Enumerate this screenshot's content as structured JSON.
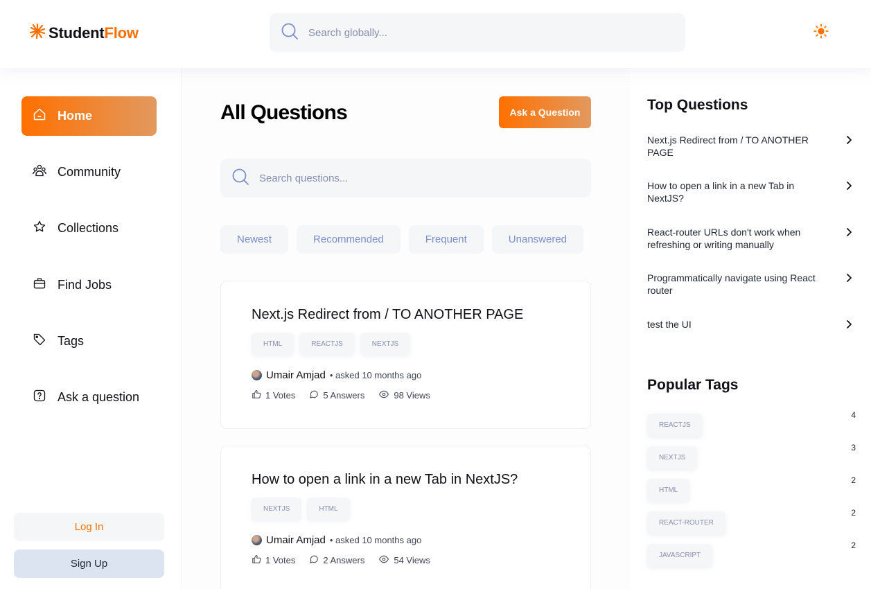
{
  "brand": {
    "name_part1": "Student",
    "name_part2": "Flow",
    "accent": "#ff7000"
  },
  "header": {
    "search_placeholder": "Search globally...",
    "theme_icon": "sun-icon"
  },
  "nav": [
    {
      "label": "Home",
      "icon": "home-icon",
      "active": true
    },
    {
      "label": "Community",
      "icon": "users-icon"
    },
    {
      "label": "Collections",
      "icon": "star-icon"
    },
    {
      "label": "Find Jobs",
      "icon": "suitcase-icon"
    },
    {
      "label": "Tags",
      "icon": "tag-icon"
    },
    {
      "label": "Ask a question",
      "icon": "question-icon"
    }
  ],
  "auth": {
    "login": "Log In",
    "signup": "Sign Up"
  },
  "main": {
    "title": "All Questions",
    "ask_button": "Ask a Question",
    "search_placeholder": "Search questions...",
    "filters": [
      "Newest",
      "Recommended",
      "Frequent",
      "Unanswered"
    ]
  },
  "questions": [
    {
      "title": "Next.js Redirect from / TO ANOTHER PAGE",
      "tags": [
        "HTML",
        "REACTJS",
        "NEXTJS"
      ],
      "author": "Umair Amjad",
      "asked": "• asked 10 months ago",
      "votes": "1 Votes",
      "answers": "5 Answers",
      "views": "98 Views"
    },
    {
      "title": "How to open a link in a new Tab in NextJS?",
      "tags": [
        "NEXTJS",
        "HTML"
      ],
      "author": "Umair Amjad",
      "asked": "• asked 10 months ago",
      "votes": "1 Votes",
      "answers": "2 Answers",
      "views": "54 Views"
    }
  ],
  "top_questions": {
    "title": "Top Questions",
    "items": [
      "Next.js Redirect from / TO ANOTHER PAGE",
      "How to open a link in a new Tab in NextJS?",
      "React-router URLs don't work when refreshing or writing manually",
      "Programmatically navigate using React router",
      "test the UI"
    ]
  },
  "popular_tags": {
    "title": "Popular Tags",
    "items": [
      {
        "name": "REACTJS",
        "count": "4"
      },
      {
        "name": "NEXTJS",
        "count": "3"
      },
      {
        "name": "HTML",
        "count": "2"
      },
      {
        "name": "REACT-ROUTER",
        "count": "2"
      },
      {
        "name": "JAVASCRIPT",
        "count": "2"
      }
    ]
  }
}
